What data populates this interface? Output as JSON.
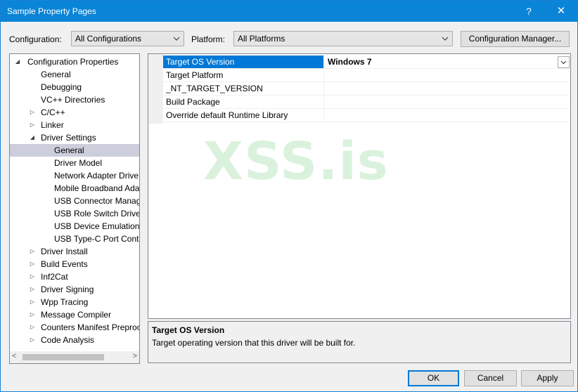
{
  "window": {
    "title": "Sample Property Pages",
    "help_glyph": "?",
    "close_glyph": "✕"
  },
  "toolbar": {
    "configuration_label": "Configuration:",
    "configuration_value": "All Configurations",
    "platform_label": "Platform:",
    "platform_value": "All Platforms",
    "config_manager_label": "Configuration Manager..."
  },
  "tree": {
    "items": [
      {
        "label": "Configuration Properties",
        "expander": "◢"
      },
      {
        "label": "General",
        "expander": ""
      },
      {
        "label": "Debugging",
        "expander": ""
      },
      {
        "label": "VC++ Directories",
        "expander": ""
      },
      {
        "label": "C/C++",
        "expander": "▷"
      },
      {
        "label": "Linker",
        "expander": "▷"
      },
      {
        "label": "Driver Settings",
        "expander": "◢"
      },
      {
        "label": "General",
        "expander": ""
      },
      {
        "label": "Driver Model",
        "expander": ""
      },
      {
        "label": "Network Adapter Drive",
        "expander": ""
      },
      {
        "label": "Mobile Broadband Ada",
        "expander": ""
      },
      {
        "label": "USB Connector Manag",
        "expander": ""
      },
      {
        "label": "USB Role Switch Driver",
        "expander": ""
      },
      {
        "label": "USB Device Emulation",
        "expander": ""
      },
      {
        "label": "USB Type-C Port Contr",
        "expander": ""
      },
      {
        "label": "Driver Install",
        "expander": "▷"
      },
      {
        "label": "Build Events",
        "expander": "▷"
      },
      {
        "label": "Inf2Cat",
        "expander": "▷"
      },
      {
        "label": "Driver Signing",
        "expander": "▷"
      },
      {
        "label": "Wpp Tracing",
        "expander": "▷"
      },
      {
        "label": "Message Compiler",
        "expander": "▷"
      },
      {
        "label": "Counters Manifest Preproc",
        "expander": "▷"
      },
      {
        "label": "Code Analysis",
        "expander": "▷"
      }
    ],
    "scroll_left": "<",
    "scroll_right": ">"
  },
  "grid": {
    "rows": [
      {
        "name": "Target OS Version",
        "value": "Windows 7"
      },
      {
        "name": "Target Platform",
        "value": ""
      },
      {
        "name": "_NT_TARGET_VERSION",
        "value": ""
      },
      {
        "name": "Build Package",
        "value": ""
      },
      {
        "name": "Override default Runtime Library",
        "value": ""
      }
    ]
  },
  "watermark": "XSS.is",
  "description": {
    "title": "Target OS Version",
    "text": "Target operating version that this driver will be built for."
  },
  "buttons": {
    "ok": "OK",
    "cancel": "Cancel",
    "apply": "Apply"
  },
  "colors": {
    "titlebar": "#0a84d6",
    "selection": "#0078d7",
    "tree_selection": "#cccedb"
  }
}
